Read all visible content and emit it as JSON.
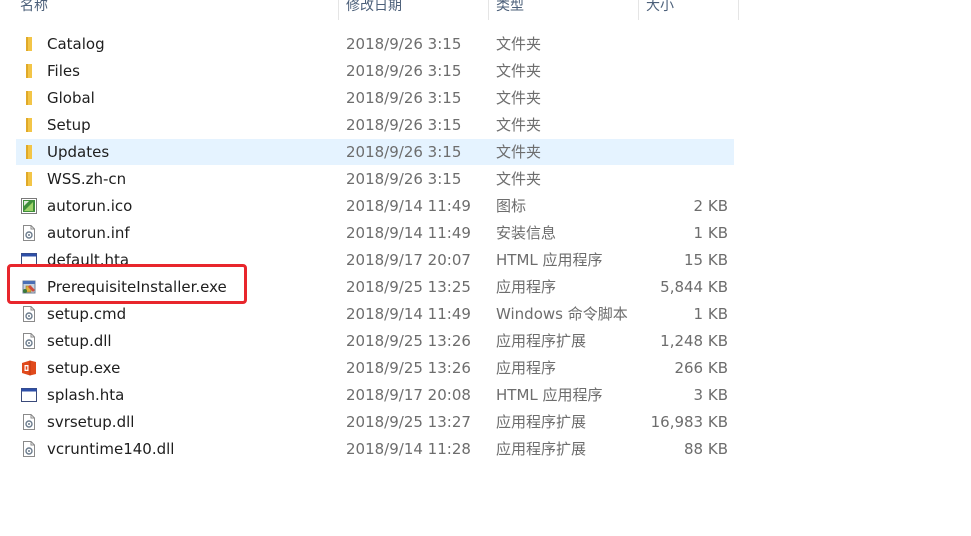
{
  "columns": {
    "name": "名称",
    "modified": "修改日期",
    "type": "类型",
    "size": "大小"
  },
  "files": [
    {
      "name": "Catalog",
      "modified": "2018/9/26 3:15",
      "type": "文件夹",
      "size": "",
      "icon": "folder-icon"
    },
    {
      "name": "Files",
      "modified": "2018/9/26 3:15",
      "type": "文件夹",
      "size": "",
      "icon": "folder-icon"
    },
    {
      "name": "Global",
      "modified": "2018/9/26 3:15",
      "type": "文件夹",
      "size": "",
      "icon": "folder-icon"
    },
    {
      "name": "Setup",
      "modified": "2018/9/26 3:15",
      "type": "文件夹",
      "size": "",
      "icon": "folder-icon"
    },
    {
      "name": "Updates",
      "modified": "2018/9/26 3:15",
      "type": "文件夹",
      "size": "",
      "icon": "folder-icon"
    },
    {
      "name": "WSS.zh-cn",
      "modified": "2018/9/26 3:15",
      "type": "文件夹",
      "size": "",
      "icon": "folder-icon"
    },
    {
      "name": "autorun.ico",
      "modified": "2018/9/14 11:49",
      "type": "图标",
      "size": "2 KB",
      "icon": "image-file-icon"
    },
    {
      "name": "autorun.inf",
      "modified": "2018/9/14 11:49",
      "type": "安装信息",
      "size": "1 KB",
      "icon": "settings-file-icon"
    },
    {
      "name": "default.hta",
      "modified": "2018/9/17 20:07",
      "type": "HTML 应用程序",
      "size": "15 KB",
      "icon": "hta-window-icon"
    },
    {
      "name": "PrerequisiteInstaller.exe",
      "modified": "2018/9/25 13:25",
      "type": "应用程序",
      "size": "5,844 KB",
      "icon": "installer-icon"
    },
    {
      "name": "setup.cmd",
      "modified": "2018/9/14 11:49",
      "type": "Windows 命令脚本",
      "size": "1 KB",
      "icon": "settings-file-icon"
    },
    {
      "name": "setup.dll",
      "modified": "2018/9/25 13:26",
      "type": "应用程序扩展",
      "size": "1,248 KB",
      "icon": "settings-file-icon"
    },
    {
      "name": "setup.exe",
      "modified": "2018/9/25 13:26",
      "type": "应用程序",
      "size": "266 KB",
      "icon": "office-icon"
    },
    {
      "name": "splash.hta",
      "modified": "2018/9/17 20:08",
      "type": "HTML 应用程序",
      "size": "3 KB",
      "icon": "hta-window-icon"
    },
    {
      "name": "svrsetup.dll",
      "modified": "2018/9/25 13:27",
      "type": "应用程序扩展",
      "size": "16,983 KB",
      "icon": "settings-file-icon"
    },
    {
      "name": "vcruntime140.dll",
      "modified": "2018/9/14 11:28",
      "type": "应用程序扩展",
      "size": "88 KB",
      "icon": "settings-file-icon"
    }
  ],
  "colors": {
    "selection": "#e5f3ff",
    "highlight_border": "#e8262c",
    "folder": "#f3c547"
  }
}
